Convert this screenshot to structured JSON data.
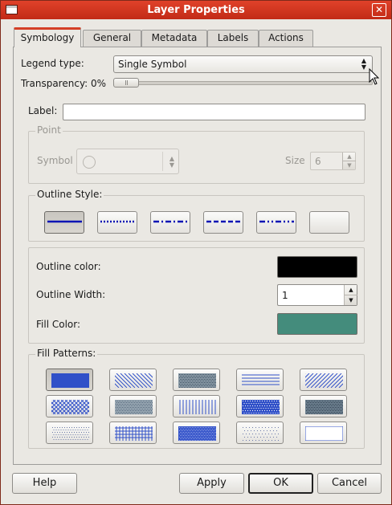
{
  "window": {
    "title": "Layer Properties",
    "close_glyph": "✕"
  },
  "tabs": [
    {
      "label": "Symbology",
      "active": true
    },
    {
      "label": "General"
    },
    {
      "label": "Metadata"
    },
    {
      "label": "Labels"
    },
    {
      "label": "Actions"
    }
  ],
  "legend": {
    "label": "Legend type:",
    "value": "Single Symbol"
  },
  "transparency": {
    "label": "Transparency: 0%",
    "value": 0
  },
  "label_field": {
    "label": "Label:",
    "value": ""
  },
  "point": {
    "title": "Point",
    "symbol_label": "Symbol",
    "size_label": "Size",
    "size_value": "6"
  },
  "outline_style": {
    "title": "Outline Style:",
    "styles": [
      "solid",
      "dot",
      "dash-dot",
      "dash",
      "dash-dot-dot",
      "none"
    ],
    "selected": 0,
    "stroke_color": "#0a14b4"
  },
  "outline": {
    "color_label": "Outline color:",
    "color": "#000000",
    "width_label": "Outline Width:",
    "width_value": "1",
    "fill_label": "Fill Color:",
    "fill_color": "#448c7c"
  },
  "fill_patterns": {
    "title": "Fill Patterns:",
    "color": "#3050c8",
    "patterns": [
      "solid",
      "fdiag",
      "dense-gray",
      "horizontal",
      "bdiag",
      "cross-diag",
      "dense-gray-2",
      "vertical",
      "dense-dots",
      "dense-gray-3",
      "sparse-dots",
      "grid",
      "dense-dots-2",
      "sparse-dots-2",
      "none"
    ],
    "selected": 0
  },
  "buttons": {
    "help": "Help",
    "apply": "Apply",
    "ok": "OK",
    "cancel": "Cancel"
  },
  "icons": {
    "window": "window-icon",
    "close": "close-icon",
    "combo_arrows": "updown-arrows-icon",
    "cursor": "mouse-pointer-icon"
  }
}
